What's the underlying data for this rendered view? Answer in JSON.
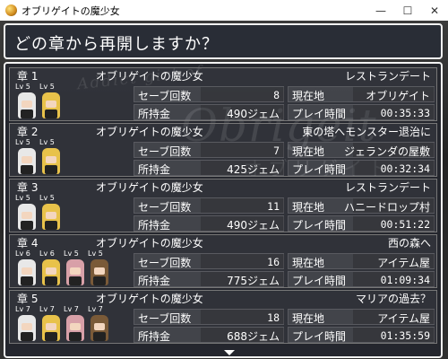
{
  "window": {
    "title": "オブリゲイトの魔少女",
    "minimize": "—",
    "maximize": "☐",
    "close": "✕"
  },
  "header": {
    "text": "どの章から再開しますか？"
  },
  "watermark": {
    "line1": "Addict girl of",
    "line2": "Obrigeit",
    "line3": "オブリゲイト"
  },
  "labels": {
    "saves": "セーブ回数",
    "money": "所持金",
    "location": "現在地",
    "playtime": "プレイ時間"
  },
  "slots": [
    {
      "chapter": "章 1",
      "game_title": "オブリゲイトの魔少女",
      "chapter_title": "レストランデート",
      "save_count": "8",
      "money": "490ジェム",
      "location": "オブリゲイト",
      "playtime": "00:35:33",
      "party": [
        {
          "lv": "Lv 5",
          "sprite": "white-hair-boy"
        },
        {
          "lv": "Lv 5",
          "sprite": "blonde-girl"
        }
      ]
    },
    {
      "chapter": "章 2",
      "game_title": "オブリゲイトの魔少女",
      "chapter_title": "東の塔へモンスター退治に",
      "save_count": "7",
      "money": "425ジェム",
      "location": "ジェランダの屋敷",
      "playtime": "00:32:34",
      "party": [
        {
          "lv": "Lv 5",
          "sprite": "white-hair-boy"
        },
        {
          "lv": "Lv 5",
          "sprite": "blonde-girl"
        }
      ]
    },
    {
      "chapter": "章 3",
      "game_title": "オブリゲイトの魔少女",
      "chapter_title": "レストランデート",
      "save_count": "11",
      "money": "490ジェム",
      "location": "ハニードロップ村",
      "playtime": "00:51:22",
      "party": [
        {
          "lv": "Lv 5",
          "sprite": "white-hair-boy"
        },
        {
          "lv": "Lv 5",
          "sprite": "blonde-girl"
        }
      ]
    },
    {
      "chapter": "章 4",
      "game_title": "オブリゲイトの魔少女",
      "chapter_title": "西の森へ",
      "save_count": "16",
      "money": "775ジェム",
      "location": "アイテム屋",
      "playtime": "01:09:34",
      "party": [
        {
          "lv": "Lv 6",
          "sprite": "white-hair-boy"
        },
        {
          "lv": "Lv 6",
          "sprite": "blonde-girl"
        },
        {
          "lv": "Lv 5",
          "sprite": "pink-hair-girl"
        },
        {
          "lv": "Lv 5",
          "sprite": "brown-hair-man"
        }
      ]
    },
    {
      "chapter": "章 5",
      "game_title": "オブリゲイトの魔少女",
      "chapter_title": "マリアの過去？",
      "save_count": "18",
      "money": "688ジェム",
      "location": "アイテム屋",
      "playtime": "01:35:59",
      "party": [
        {
          "lv": "Lv 7",
          "sprite": "white-hair-boy"
        },
        {
          "lv": "Lv 7",
          "sprite": "blonde-girl"
        },
        {
          "lv": "Lv 7",
          "sprite": "pink-hair-girl"
        },
        {
          "lv": "Lv 7",
          "sprite": "brown-hair-man"
        }
      ]
    }
  ],
  "sprite_colors": {
    "white-hair-boy": "#e8e8e8",
    "blonde-girl": "#e8c24a",
    "pink-hair-girl": "#d8a0a8",
    "brown-hair-man": "#7a5a38"
  },
  "more_indicator": "down-arrow-icon"
}
